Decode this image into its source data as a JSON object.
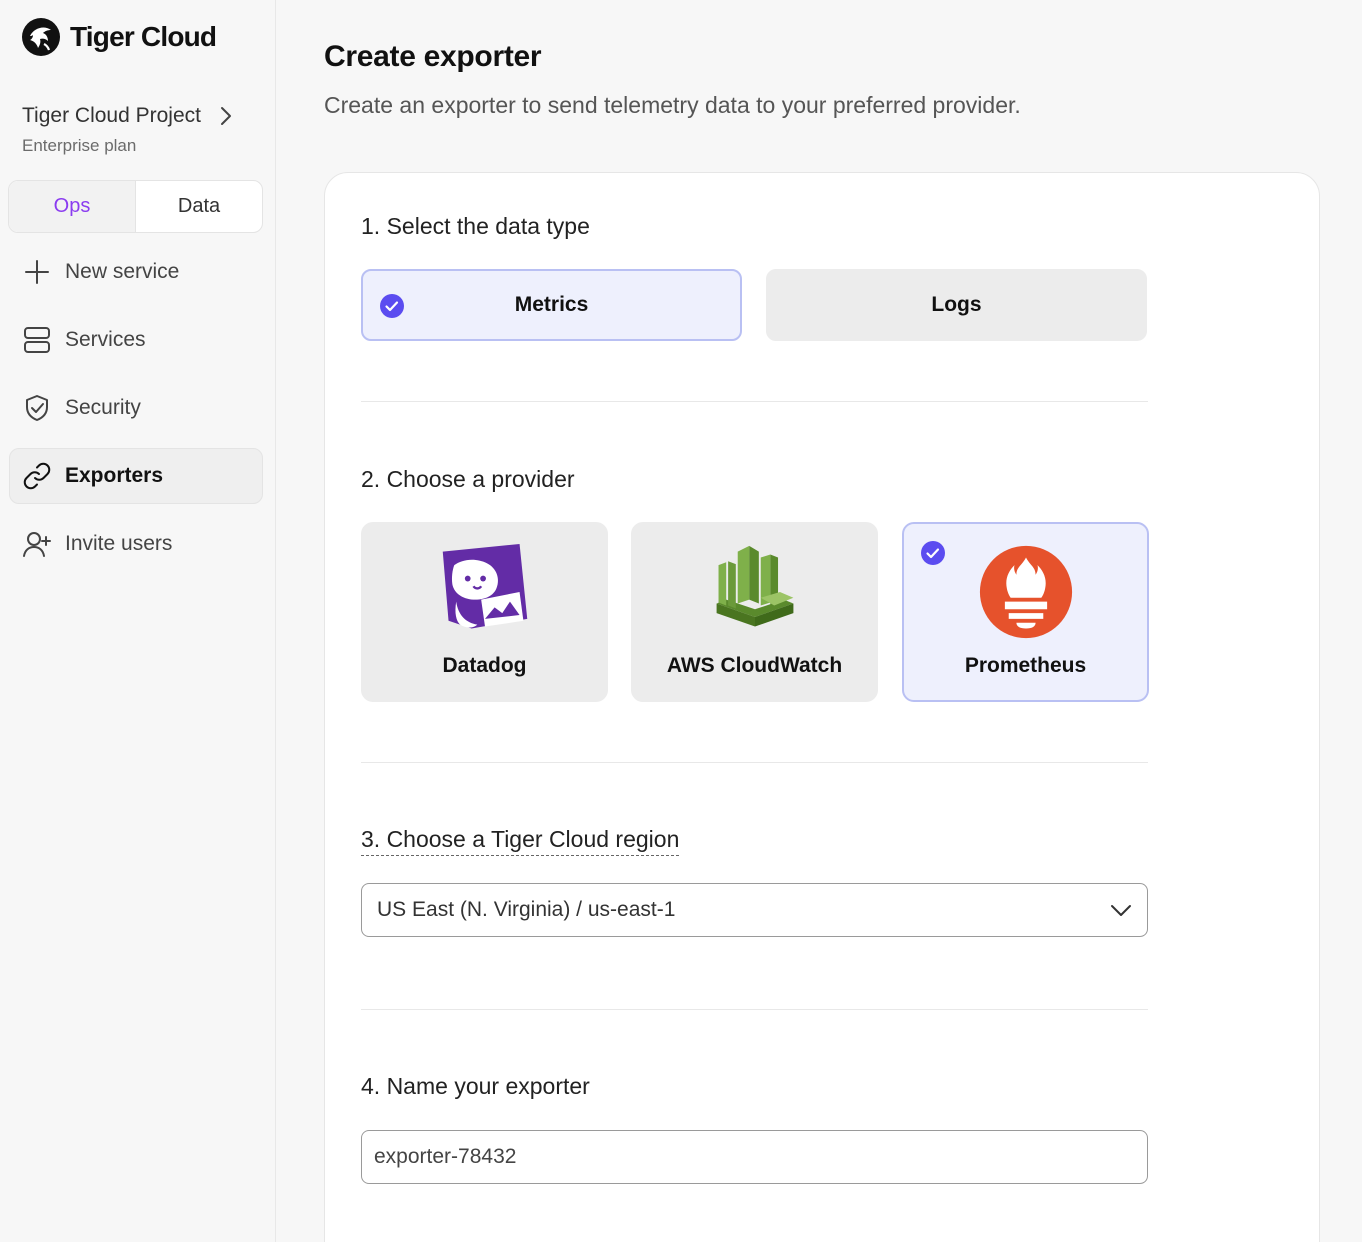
{
  "app": {
    "name": "Tiger Cloud"
  },
  "project": {
    "name": "Tiger Cloud Project",
    "plan": "Enterprise plan"
  },
  "mode_tabs": [
    {
      "label": "Ops",
      "active": true
    },
    {
      "label": "Data",
      "active": false
    }
  ],
  "nav": [
    {
      "label": "New service",
      "icon": "plus-icon"
    },
    {
      "label": "Services",
      "icon": "server-icon"
    },
    {
      "label": "Security",
      "icon": "shield-check-icon"
    },
    {
      "label": "Exporters",
      "icon": "link-icon",
      "active": true
    },
    {
      "label": "Invite users",
      "icon": "user-plus-icon"
    }
  ],
  "page": {
    "title": "Create exporter",
    "subtitle": "Create an exporter to send telemetry data to your preferred provider."
  },
  "step1": {
    "title": "1. Select the data type",
    "options": [
      {
        "label": "Metrics",
        "selected": true
      },
      {
        "label": "Logs",
        "selected": false
      }
    ]
  },
  "step2": {
    "title": "2. Choose a provider",
    "providers": [
      {
        "label": "Datadog",
        "icon": "datadog-logo",
        "selected": false
      },
      {
        "label": "AWS CloudWatch",
        "icon": "aws-cloudwatch-logo",
        "selected": false
      },
      {
        "label": "Prometheus",
        "icon": "prometheus-logo",
        "selected": true
      }
    ]
  },
  "step3": {
    "title": "3. Choose a Tiger Cloud region",
    "region_value": "US East (N. Virginia) / us-east-1"
  },
  "step4": {
    "title": "4. Name your exporter",
    "name_value": "exporter-78432"
  },
  "colors": {
    "accent": "#5b4cf0",
    "selected_bg": "#eef0fd",
    "selected_border": "#b9c0f3",
    "prometheus": "#e6522c",
    "datadog": "#632ca6",
    "aws_green": "#6b9a3a"
  }
}
